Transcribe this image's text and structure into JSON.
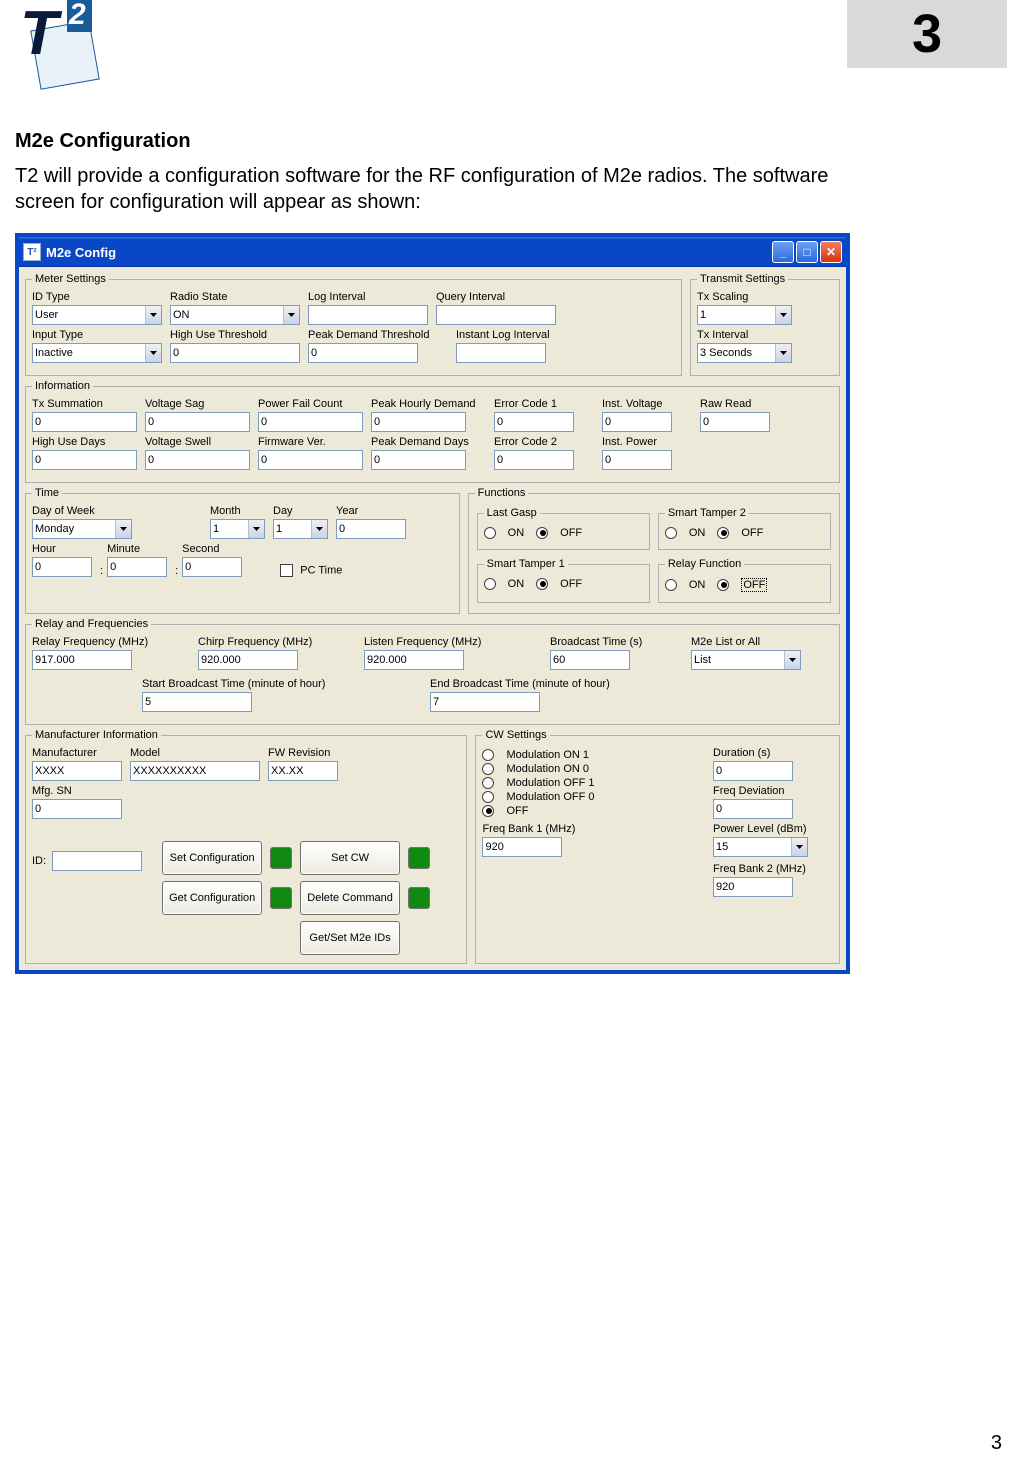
{
  "chapter_number": "3",
  "heading": "M2e Configuration",
  "paragraph": "T2 will provide a configuration software for the RF configuration of  M2e radios.  The software screen for configuration will appear as shown:",
  "page_number": "3",
  "window": {
    "title": "M2e Config",
    "appicon": "T²",
    "groups": {
      "meter": {
        "legend": "Meter Settings",
        "id_type_lbl": "ID Type",
        "id_type_val": "User",
        "radio_state_lbl": "Radio State",
        "radio_state_val": "ON",
        "log_interval_lbl": "Log Interval",
        "log_interval_val": "",
        "query_interval_lbl": "Query Interval",
        "query_interval_val": "",
        "input_type_lbl": "Input Type",
        "input_type_val": "Inactive",
        "high_use_lbl": "High Use Threshold",
        "high_use_val": "0",
        "peak_dem_lbl": "Peak Demand Threshold",
        "peak_dem_val": "0",
        "instant_log_lbl": "Instant Log Interval",
        "instant_log_val": ""
      },
      "transmit": {
        "legend": "Transmit Settings",
        "tx_scaling_lbl": "Tx Scaling",
        "tx_scaling_val": "1",
        "tx_interval_lbl": "Tx Interval",
        "tx_interval_val": "3 Seconds"
      },
      "info": {
        "legend": "Information",
        "tx_sum_lbl": "Tx Summation",
        "tx_sum_val": "0",
        "vsag_lbl": "Voltage Sag",
        "vsag_val": "0",
        "pfc_lbl": "Power Fail Count",
        "pfc_val": "0",
        "phd_lbl": "Peak Hourly Demand",
        "phd_val": "0",
        "ec1_lbl": "Error Code 1",
        "ec1_val": "0",
        "iv_lbl": "Inst. Voltage",
        "iv_val": "0",
        "rr_lbl": "Raw Read",
        "rr_val": "0",
        "hud_lbl": "High Use Days",
        "hud_val": "0",
        "vsw_lbl": "Voltage Swell",
        "vsw_val": "0",
        "fw_lbl": "Firmware Ver.",
        "fw_val": "0",
        "pdd_lbl": "Peak Demand Days",
        "pdd_val": "0",
        "ec2_lbl": "Error Code 2",
        "ec2_val": "0",
        "ip_lbl": "Inst. Power",
        "ip_val": "0"
      },
      "time": {
        "legend": "Time",
        "dow_lbl": "Day of Week",
        "dow_val": "Monday",
        "month_lbl": "Month",
        "month_val": "1",
        "day_lbl": "Day",
        "day_val": "1",
        "year_lbl": "Year",
        "year_val": "0",
        "hour_lbl": "Hour",
        "hour_val": "0",
        "min_lbl": "Minute",
        "min_val": "0",
        "sec_lbl": "Second",
        "sec_val": "0",
        "pc_time_lbl": "PC Time"
      },
      "functions": {
        "legend": "Functions",
        "lg_legend": "Last Gasp",
        "st1_legend": "Smart Tamper 1",
        "st2_legend": "Smart Tamper 2",
        "relay_legend": "Relay Function",
        "on_lbl": "ON",
        "off_lbl": "OFF"
      },
      "relay": {
        "legend": "Relay and Frequencies",
        "rfmhz_lbl": "Relay Frequency (MHz)",
        "rfmhz_val": "917.000",
        "cfmhz_lbl": "Chirp Frequency (MHz)",
        "cfmhz_val": "920.000",
        "lfmhz_lbl": "Listen Frequency (MHz)",
        "lfmhz_val": "920.000",
        "bct_lbl": "Broadcast Time (s)",
        "bct_val": "60",
        "m2e_lbl": "M2e List or All",
        "m2e_val": "List",
        "sbt_lbl": "Start Broadcast Time (minute of hour)",
        "sbt_val": "5",
        "ebt_lbl": "End Broadcast Time (minute of hour)",
        "ebt_val": "7"
      },
      "mfg": {
        "legend": "Manufacturer Information",
        "man_lbl": "Manufacturer",
        "man_val": "XXXX",
        "model_lbl": "Model",
        "model_val": "XXXXXXXXXX",
        "fwr_lbl": "FW Revision",
        "fwr_val": "XX.XX",
        "sn_lbl": "Mfg. SN",
        "sn_val": "0",
        "id_lbl": "ID:",
        "set_cfg_btn": "Set Configuration",
        "get_cfg_btn": "Get Configuration",
        "set_cw_btn": "Set CW",
        "del_cmd_btn": "Delete Command",
        "gs_ids_btn": "Get/Set M2e IDs"
      },
      "cw": {
        "legend": "CW Settings",
        "m1_lbl": "Modulation ON 1",
        "m0_lbl": "Modulation ON 0",
        "mo1_lbl": "Modulation OFF 1",
        "mo0_lbl": "Modulation OFF 0",
        "off_lbl": "OFF",
        "dur_lbl": "Duration (s)",
        "dur_val": "0",
        "fd_lbl": "Freq Deviation",
        "fd_val": "0",
        "pl_lbl": "Power Level (dBm)",
        "pl_val": "15",
        "fb1_lbl": "Freq Bank 1 (MHz)",
        "fb1_val": "920",
        "fb2_lbl": "Freq Bank 2 (MHz)",
        "fb2_val": "920"
      }
    }
  }
}
